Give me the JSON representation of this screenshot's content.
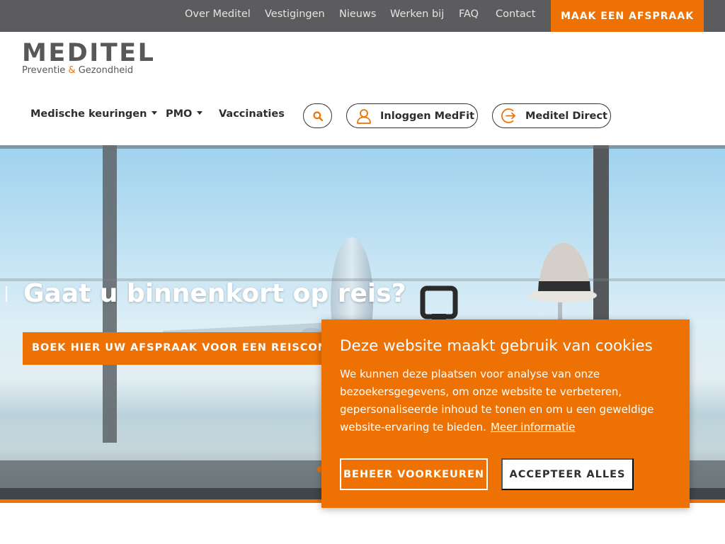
{
  "topbar": {
    "links": [
      "Over Meditel",
      "Vestigingen",
      "Nieuws",
      "Werken bij",
      "FAQ",
      "Contact"
    ],
    "cta": "MAAK EEN AFSPRAAK"
  },
  "logo": {
    "wordmark": "MEDITEL",
    "tagline_part1": "Preventie ",
    "tagline_amp": "&",
    "tagline_part2": " Gezondheid"
  },
  "nav": {
    "items": [
      "Medische keuringen",
      "PMO",
      "Vaccinaties"
    ],
    "search_icon": "search-icon",
    "login_label": "Inloggen MedFit",
    "login_icon": "user-icon",
    "direct_label": "Meditel Direct",
    "direct_icon": "arrow-circle-icon"
  },
  "hero": {
    "title": "Gaat u binnenkort op reis?",
    "button": "BOEK HIER UW AFSPRAAK VOOR EEN REISCONSULT"
  },
  "cookie": {
    "title": "Deze website maakt gebruik van cookies",
    "text": "We kunnen deze plaatsen voor analyse van onze bezoekersgegevens, om onze website te verbeteren, gepersonaliseerde inhoud te tonen en om u een geweldige website-ervaring te bieden.",
    "link": "Meer informatie",
    "manage_button": "BEHEER VOORKEUREN",
    "accept_button": "ACCEPTEER ALLES"
  },
  "colors": {
    "brand_orange": "#ee7203",
    "topbar_gray": "#5c5c5e",
    "logo_gray": "#58585a",
    "text_dark": "#2e2e2e"
  }
}
